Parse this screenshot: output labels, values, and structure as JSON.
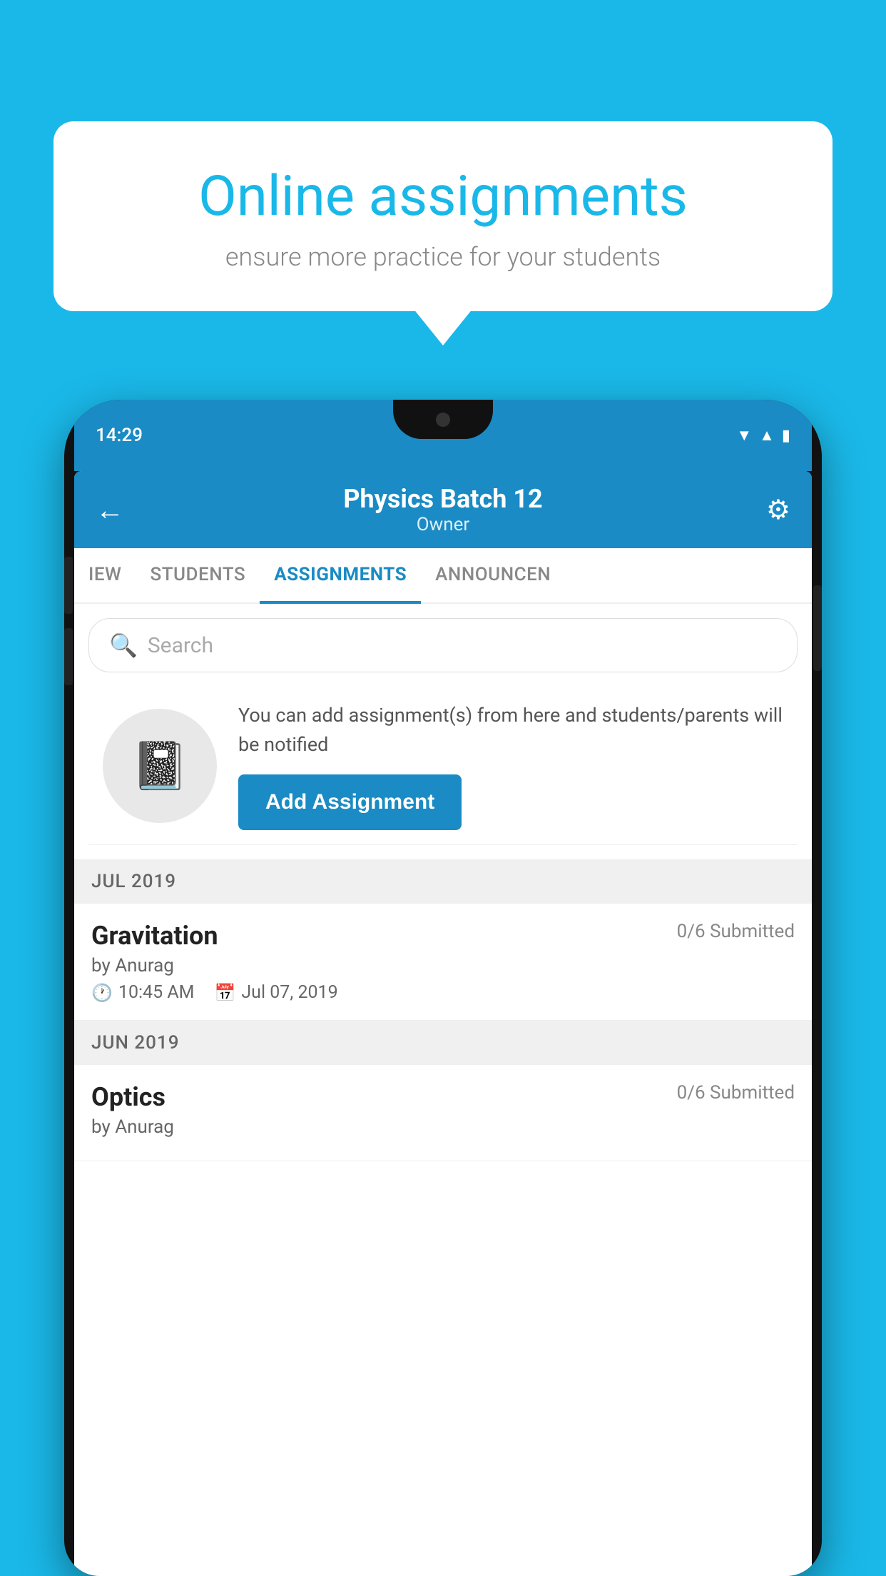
{
  "background_color": "#1ab8e8",
  "speech_bubble": {
    "title": "Online assignments",
    "subtitle": "ensure more practice for your students"
  },
  "phone": {
    "status_bar": {
      "time": "14:29",
      "icons": [
        "wifi",
        "signal",
        "battery"
      ]
    },
    "header": {
      "title": "Physics Batch 12",
      "subtitle": "Owner",
      "back_label": "←",
      "gear_label": "⚙"
    },
    "tabs": [
      {
        "label": "IEW",
        "active": false
      },
      {
        "label": "STUDENTS",
        "active": false
      },
      {
        "label": "ASSIGNMENTS",
        "active": true
      },
      {
        "label": "ANNOUNCEN",
        "active": false
      }
    ],
    "search": {
      "placeholder": "Search"
    },
    "empty_state": {
      "description": "You can add assignment(s) from here and students/parents will be notified",
      "button_label": "Add Assignment"
    },
    "sections": [
      {
        "header": "JUL 2019",
        "assignments": [
          {
            "name": "Gravitation",
            "submitted": "0/6 Submitted",
            "by": "by Anurag",
            "time": "10:45 AM",
            "date": "Jul 07, 2019"
          }
        ]
      },
      {
        "header": "JUN 2019",
        "assignments": [
          {
            "name": "Optics",
            "submitted": "0/6 Submitted",
            "by": "by Anurag",
            "time": "",
            "date": ""
          }
        ]
      }
    ]
  }
}
